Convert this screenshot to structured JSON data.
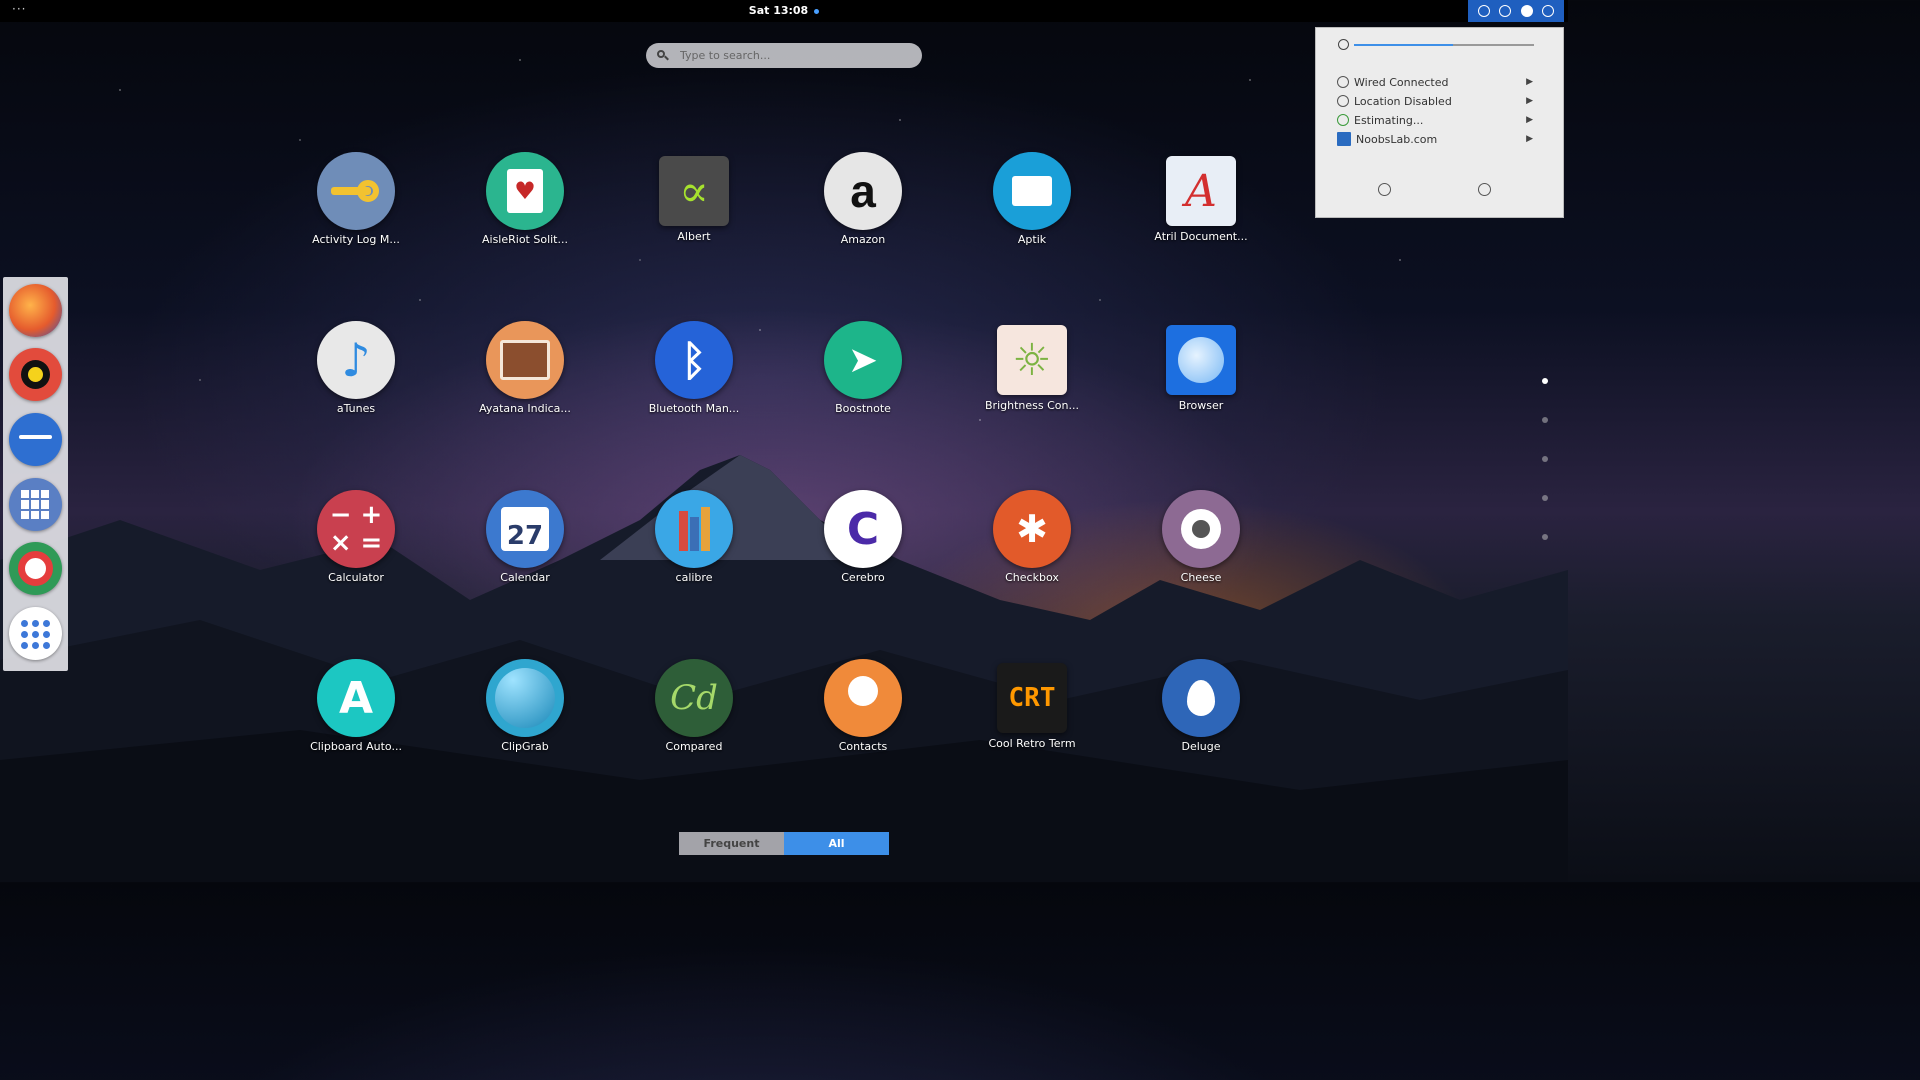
{
  "topbar": {
    "menu_dots": "···",
    "clock": "Sat 13:08"
  },
  "search": {
    "placeholder": "Type to search..."
  },
  "dock": {
    "items": [
      {
        "name": "firefox",
        "color": "#e55b2d"
      },
      {
        "name": "music-player",
        "color": "#e24b3c"
      },
      {
        "name": "files",
        "color": "#2e6fd1"
      },
      {
        "name": "app-grid",
        "color": "#5a7fc4"
      },
      {
        "name": "help",
        "color": "#2f9a57"
      },
      {
        "name": "show-apps",
        "color": "#ffffff"
      }
    ]
  },
  "apps": [
    {
      "label": "Activity Log M...",
      "icon": "key-icon",
      "color": "#6f8db8"
    },
    {
      "label": "AisleRiot Solit...",
      "icon": "cards-icon",
      "color": "#2bb58f"
    },
    {
      "label": "Albert",
      "icon": "albert-icon",
      "color": "#4a4a4a"
    },
    {
      "label": "Amazon",
      "icon": "amazon-icon",
      "color": "#e6e6e6"
    },
    {
      "label": "Aptik",
      "icon": "box-icon",
      "color": "#1a9fd8"
    },
    {
      "label": "Atril Document...",
      "icon": "document-icon",
      "color": "#e8eef6"
    },
    {
      "label": "aTunes",
      "icon": "music-note-icon",
      "color": "#e8e8e8"
    },
    {
      "label": "Ayatana Indica...",
      "icon": "window-icon",
      "color": "#e9965a"
    },
    {
      "label": "Bluetooth Man...",
      "icon": "bluetooth-icon",
      "color": "#2563d8"
    },
    {
      "label": "Boostnote",
      "icon": "paper-plane-icon",
      "color": "#1db58a"
    },
    {
      "label": "Brightness Con...",
      "icon": "sun-icon",
      "color": "#f6e6de"
    },
    {
      "label": "Browser",
      "icon": "globe-icon",
      "color": "#1d6fe0"
    },
    {
      "label": "Calculator",
      "icon": "calculator-icon",
      "color": "#c9404f"
    },
    {
      "label": "Calendar",
      "icon": "calendar-icon",
      "color": "#3c79cf"
    },
    {
      "label": "calibre",
      "icon": "books-icon",
      "color": "#3aa7e6"
    },
    {
      "label": "Cerebro",
      "icon": "cerebro-icon",
      "color": "#ffffff"
    },
    {
      "label": "Checkbox",
      "icon": "checkbox-icon",
      "color": "#e25a2a"
    },
    {
      "label": "Cheese",
      "icon": "camera-icon",
      "color": "#8d6a93"
    },
    {
      "label": "Clipboard Auto...",
      "icon": "clipboard-icon",
      "color": "#1cc7c2"
    },
    {
      "label": "ClipGrab",
      "icon": "clipgrab-icon",
      "color": "#2fa6cf"
    },
    {
      "label": "Compared",
      "icon": "compared-icon",
      "color": "#2e5e38"
    },
    {
      "label": "Contacts",
      "icon": "contact-icon",
      "color": "#f08a3a"
    },
    {
      "label": "Cool Retro Term",
      "icon": "terminal-icon",
      "color": "#1a1a1a"
    },
    {
      "label": "Deluge",
      "icon": "drop-icon",
      "color": "#2e66b8"
    }
  ],
  "calendar_day": "27",
  "crt_text": "CRT",
  "tabs": {
    "frequent": "Frequent",
    "all": "All"
  },
  "status_menu": {
    "volume_level": 0.55,
    "items": [
      {
        "label": "Wired Connected",
        "icon": "network-icon"
      },
      {
        "label": "Location Disabled",
        "icon": "location-icon"
      },
      {
        "label": "Estimating...",
        "icon": "battery-icon"
      },
      {
        "label": "NoobsLab.com",
        "icon": "user-icon"
      }
    ]
  },
  "pages": {
    "count": 5,
    "active": 0
  },
  "colors": {
    "accent": "#3d8fe8",
    "tray": "#1f5fbf"
  }
}
